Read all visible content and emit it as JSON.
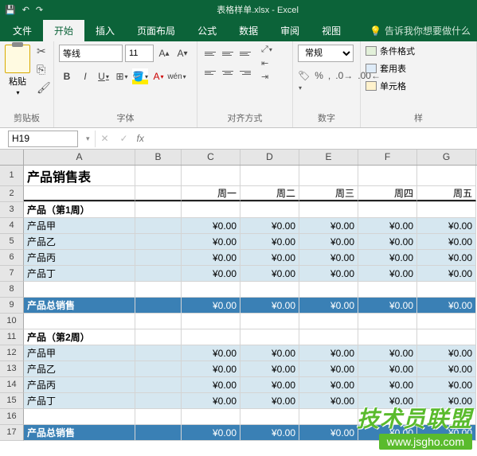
{
  "title_bar": {
    "filename": "表格样单.xlsx - Excel"
  },
  "tabs": {
    "file": "文件",
    "home": "开始",
    "insert": "插入",
    "layout": "页面布局",
    "formulas": "公式",
    "data": "数据",
    "review": "审阅",
    "view": "视图",
    "tellme": "告诉我你想要做什么"
  },
  "ribbon": {
    "paste": "粘贴",
    "clipboard": "剪贴板",
    "font_name": "等线",
    "font_size": "11",
    "font_group": "字体",
    "align_group": "对齐方式",
    "number_format": "常规",
    "number_group": "数字",
    "cond_format": "条件格式",
    "table_format": "套用表",
    "cell_style": "单元格",
    "styles_group": "样"
  },
  "name_box": "H19",
  "columns": [
    "A",
    "B",
    "C",
    "D",
    "E",
    "F",
    "G"
  ],
  "rows": [
    "1",
    "2",
    "3",
    "4",
    "5",
    "6",
    "7",
    "8",
    "9",
    "10",
    "11",
    "12",
    "13",
    "14",
    "15",
    "16",
    "17"
  ],
  "sheet": {
    "title": "产品销售表",
    "days": [
      "周一",
      "周二",
      "周三",
      "周四",
      "周五"
    ],
    "section1": "产品（第1周）",
    "section2": "产品（第2周）",
    "products": [
      "产品甲",
      "产品乙",
      "产品丙",
      "产品丁"
    ],
    "total": "产品总销售",
    "val": "¥0.00"
  },
  "watermark": {
    "title": "技术员联盟",
    "url": "www.jsgho.com"
  },
  "chart_data": {
    "type": "table",
    "title": "产品销售表",
    "sections": [
      {
        "name": "产品（第1周）",
        "columns": [
          "周一",
          "周二",
          "周三",
          "周四",
          "周五"
        ],
        "rows": [
          {
            "product": "产品甲",
            "values": [
              0,
              0,
              0,
              0,
              0
            ]
          },
          {
            "product": "产品乙",
            "values": [
              0,
              0,
              0,
              0,
              0
            ]
          },
          {
            "product": "产品丙",
            "values": [
              0,
              0,
              0,
              0,
              0
            ]
          },
          {
            "product": "产品丁",
            "values": [
              0,
              0,
              0,
              0,
              0
            ]
          }
        ],
        "total": {
          "label": "产品总销售",
          "values": [
            0,
            0,
            0,
            0,
            0
          ]
        }
      },
      {
        "name": "产品（第2周）",
        "columns": [
          "周一",
          "周二",
          "周三",
          "周四",
          "周五"
        ],
        "rows": [
          {
            "product": "产品甲",
            "values": [
              0,
              0,
              0,
              0,
              0
            ]
          },
          {
            "product": "产品乙",
            "values": [
              0,
              0,
              0,
              0,
              0
            ]
          },
          {
            "product": "产品丙",
            "values": [
              0,
              0,
              0,
              0,
              0
            ]
          },
          {
            "product": "产品丁",
            "values": [
              0,
              0,
              0,
              0,
              0
            ]
          }
        ],
        "total": {
          "label": "产品总销售",
          "values": [
            0,
            0,
            0,
            0,
            0
          ]
        }
      }
    ],
    "currency": "¥"
  }
}
